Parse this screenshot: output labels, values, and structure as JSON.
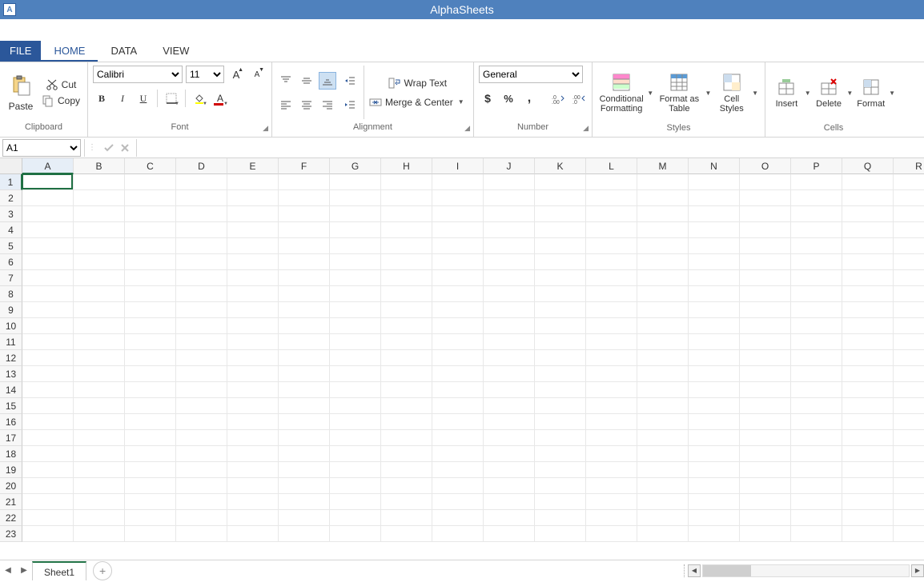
{
  "app": {
    "title": "AlphaSheets"
  },
  "tabs": {
    "file": "FILE",
    "home": "HOME",
    "data": "DATA",
    "view": "VIEW"
  },
  "ribbon": {
    "clipboard": {
      "paste": "Paste",
      "cut": "Cut",
      "copy": "Copy",
      "label": "Clipboard"
    },
    "font": {
      "name": "Calibri",
      "size": "11",
      "label": "Font"
    },
    "alignment": {
      "wrap": "Wrap Text",
      "merge": "Merge &  Center",
      "label": "Alignment"
    },
    "number": {
      "format": "General",
      "label": "Number"
    },
    "styles": {
      "cond": "Conditional Formatting",
      "fat": "Format as Table",
      "cs": "Cell Styles",
      "label": "Styles"
    },
    "cells": {
      "insert": "Insert",
      "delete": "Delete",
      "format": "Format",
      "label": "Cells"
    }
  },
  "formula": {
    "namebox": "A1"
  },
  "grid": {
    "cols": [
      "A",
      "B",
      "C",
      "D",
      "E",
      "F",
      "G",
      "H",
      "I",
      "J",
      "K",
      "L",
      "M",
      "N",
      "O",
      "P",
      "Q",
      "R"
    ],
    "rows": [
      "1",
      "2",
      "3",
      "4",
      "5",
      "6",
      "7",
      "8",
      "9",
      "10",
      "11",
      "12",
      "13",
      "14",
      "15",
      "16",
      "17",
      "18",
      "19",
      "20",
      "21",
      "22",
      "23"
    ],
    "selected_col": "A",
    "selected_row": "1"
  },
  "sheet": {
    "active": "Sheet1"
  }
}
